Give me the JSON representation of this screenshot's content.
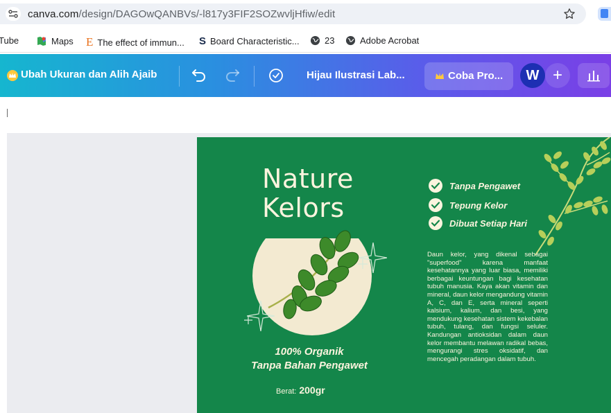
{
  "browser": {
    "url_domain": "canva.com",
    "url_path": "/design/DAGOwQANBVs/-l817y3FIF2SOZwvljHfiw/edit",
    "bookmarks": [
      {
        "label": "Tube",
        "icon": "youtube-icon"
      },
      {
        "label": "Maps",
        "icon": "maps-icon"
      },
      {
        "label": "The effect of immun...",
        "icon": "elsevier-icon"
      },
      {
        "label": "Board Characteristic...",
        "icon": "scribd-icon"
      },
      {
        "label": "23",
        "icon": "globe-icon"
      },
      {
        "label": "Adobe Acrobat",
        "icon": "globe-icon"
      }
    ]
  },
  "canva": {
    "resize_label": "Ubah Ukuran dan Alih Ajaib",
    "doc_title": "Hijau Ilustrasi Lab...",
    "pro_label": "Coba Pro...",
    "avatar_initial": "W",
    "plus_label": "+",
    "gradient_colors": [
      "#16b6cf",
      "#7a3fe6"
    ]
  },
  "design": {
    "bg_color": "#14864a",
    "cream_color": "#fbf4de",
    "title_line1": "Nature",
    "title_line2": "Kelors",
    "checks": [
      "Tanpa Pengawet",
      "Tepung Kelor",
      "Dibuat Setiap Hari"
    ],
    "description": "Daun kelor, yang dikenal sebagai \"superfood\" karena manfaat kesehatannya yang luar biasa, memiliki berbagai keuntungan bagi kesehatan tubuh manusia. Kaya akan vitamin dan mineral, daun kelor mengandung vitamin A, C, dan E, serta mineral seperti kalsium, kalium, dan besi, yang mendukung kesehatan sistem kekebalan tubuh, tulang, dan fungsi seluler. Kandungan antioksidan dalam daun kelor membantu melawan radikal bebas, mengurangi stres oksidatif, dan mencegah peradangan dalam tubuh.",
    "organik_line1": "100% Organik",
    "organik_line2": "Tanpa Bahan Pengawet",
    "weight_label": "Berat:",
    "weight_value": "200gr"
  }
}
